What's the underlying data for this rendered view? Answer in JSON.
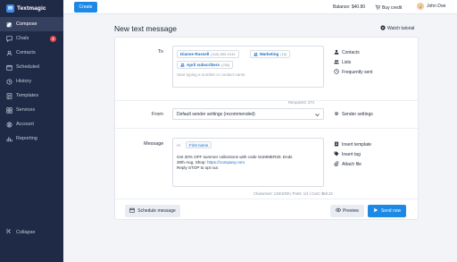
{
  "app": {
    "name": "Textmagic"
  },
  "colors": {
    "sidebar": "#1f2b46",
    "accent": "#1e88e5",
    "badge": "#e5484d"
  },
  "sidebar": {
    "items": [
      {
        "label": "Compose",
        "icon": "compose-icon",
        "active": true
      },
      {
        "label": "Chats",
        "icon": "chat-icon",
        "badge": "2"
      },
      {
        "label": "Contacts",
        "icon": "contacts-icon"
      },
      {
        "label": "Scheduled",
        "icon": "calendar-icon"
      },
      {
        "label": "History",
        "icon": "history-icon"
      },
      {
        "label": "Templates",
        "icon": "templates-icon"
      },
      {
        "label": "Services",
        "icon": "services-icon"
      },
      {
        "label": "Account",
        "icon": "account-icon"
      },
      {
        "label": "Reporting",
        "icon": "reporting-icon"
      }
    ],
    "collapse_label": "Collapse"
  },
  "topbar": {
    "create_label": "Create",
    "balance": "Balance: $40.80",
    "buy_credit": "Buy credit",
    "user_name": "John Doe",
    "user_initials": "J"
  },
  "page": {
    "title": "New text message",
    "watch_tutorial": "Watch tutorial"
  },
  "to": {
    "label": "To",
    "chips": [
      {
        "name": "Dianne Russell",
        "sub": "(415) 555-0132"
      },
      {
        "name": "Marketing",
        "sub": "(18)"
      },
      {
        "name": "April subscribers",
        "sub": "(255)"
      }
    ],
    "placeholder": "Start typing a number or contact name",
    "recipients": "Recipients: 274",
    "links": [
      "Contacts",
      "Lists",
      "Frequently sent"
    ]
  },
  "from": {
    "label": "From",
    "value": "Default sender settings (recommended)",
    "link": "Sender settings"
  },
  "message": {
    "label": "Message",
    "greeting": "Hi",
    "tag": "First name",
    "lines": [
      "Get 30% OFF summer collections with code SUMMER30. Ends",
      "30th Aug. Shop: "
    ],
    "link": "https://company.com",
    "line_end": "Reply STOP to opt out.",
    "counts": "Characters: 129/1000  |  Parts: 1/4  |  Cost: $58.32",
    "links": [
      "Insert template",
      "Insert tag",
      "Attach file"
    ]
  },
  "footer": {
    "schedule_label": "Schedule message",
    "preview_label": "Preview",
    "send_label": "Send now"
  }
}
